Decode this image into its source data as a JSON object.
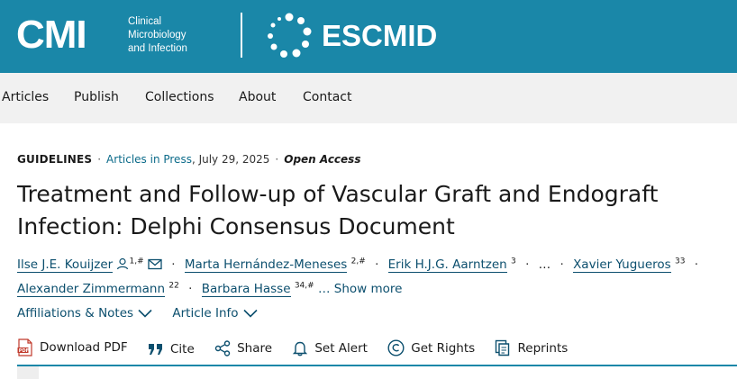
{
  "banner": {
    "logo_text": "CMI",
    "subtitle_lines": [
      "Clinical",
      "Microbiology",
      "and Infection"
    ],
    "partner_text": "ESCMID",
    "color": "#1a87a8"
  },
  "nav": {
    "items": [
      "Articles",
      "Publish",
      "Collections",
      "About",
      "Contact"
    ]
  },
  "meta": {
    "type": "GUIDELINES",
    "section": "Articles in Press",
    "date": ", July 29, 2025",
    "access": "Open Access"
  },
  "article": {
    "title": "Treatment and Follow-up of Vascular Graft and Endograft Infection: Delphi Consensus Document"
  },
  "authors": {
    "list": [
      {
        "name": "Ilse J.E. Kouijzer",
        "sup": "1,#"
      },
      {
        "name": "Marta Hernández-Meneses",
        "sup": "2,#"
      },
      {
        "name": "Erik H.J.G. Aarntzen",
        "sup": "3"
      },
      {
        "name": "Xavier Yugueros",
        "sup": "33"
      },
      {
        "name": "Alexander Zimmermann",
        "sup": "22"
      },
      {
        "name": "Barbara Hasse",
        "sup": "34,#"
      }
    ],
    "ellipsis": "…",
    "show_more": "… Show more"
  },
  "info": {
    "affiliations": "Affiliations & Notes",
    "article_info": "Article Info"
  },
  "actions": {
    "download_pdf": "Download PDF",
    "cite": "Cite",
    "share": "Share",
    "set_alert": "Set Alert",
    "get_rights": "Get Rights",
    "reprints": "Reprints"
  },
  "icons": [
    "pdf-icon",
    "quote-icon",
    "share-icon",
    "bell-icon",
    "copyright-icon",
    "reprints-icon",
    "person-icon",
    "envelope-icon",
    "chevron-down-icon"
  ],
  "colors": {
    "brand": "#1a87a8",
    "link": "#0c4f6e"
  }
}
